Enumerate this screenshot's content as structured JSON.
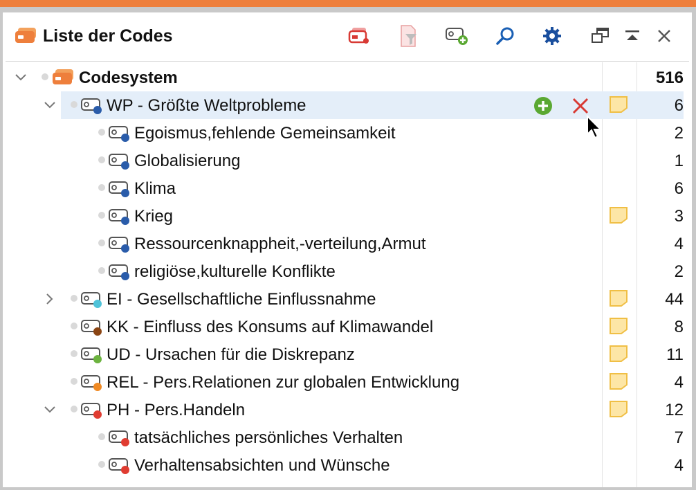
{
  "window": {
    "title": "Liste der Codes",
    "accent_color": "#ee7f3c"
  },
  "toolbar": {
    "buttons": [
      {
        "name": "coded-segments-icon"
      },
      {
        "name": "filter-document-icon"
      },
      {
        "name": "new-code-icon"
      },
      {
        "name": "search-icon"
      },
      {
        "name": "settings-gear-icon"
      },
      {
        "name": "undock-window-icon"
      },
      {
        "name": "collapse-panel-icon"
      },
      {
        "name": "close-icon"
      }
    ]
  },
  "tree": {
    "root": {
      "label": "Codesystem",
      "count": "516"
    },
    "rows": [
      {
        "label": "WP - Größte Weltprobleme",
        "count": "6",
        "level": 1,
        "expanded": true,
        "color": "#2a5caa",
        "memo": true,
        "selected": true
      },
      {
        "label": "Egoismus,fehlende Gemeinsamkeit",
        "count": "2",
        "level": 2,
        "color": "#2a5caa",
        "memo": false
      },
      {
        "label": "Globalisierung",
        "count": "1",
        "level": 2,
        "color": "#2a5caa",
        "memo": false
      },
      {
        "label": "Klima",
        "count": "6",
        "level": 2,
        "color": "#2a5caa",
        "memo": false
      },
      {
        "label": "Krieg",
        "count": "3",
        "level": 2,
        "color": "#2a5caa",
        "memo": true
      },
      {
        "label": "Ressourcenknappheit,-verteilung,Armut",
        "count": "4",
        "level": 2,
        "color": "#2a5caa",
        "memo": false
      },
      {
        "label": "religiöse,kulturelle Konflikte",
        "count": "2",
        "level": 2,
        "color": "#2a5caa",
        "memo": false
      },
      {
        "label": "EI - Gesellschaftliche Einflussnahme",
        "count": "44",
        "level": 1,
        "expanded": false,
        "color": "#4fc3d9",
        "memo": true
      },
      {
        "label": "KK - Einfluss des Konsums auf Klimawandel",
        "count": "8",
        "level": 1,
        "color": "#8b4513",
        "memo": true
      },
      {
        "label": "UD - Ursachen für die Diskrepanz",
        "count": "11",
        "level": 1,
        "color": "#6cb33f",
        "memo": true
      },
      {
        "label": "REL - Pers.Relationen zur globalen Entwicklung",
        "count": "4",
        "level": 1,
        "color": "#f08a24",
        "memo": true
      },
      {
        "label": "PH - Pers.Handeln",
        "count": "12",
        "level": 1,
        "expanded": true,
        "color": "#e03c31",
        "memo": true
      },
      {
        "label": "tatsächliches persönliches Verhalten",
        "count": "7",
        "level": 2,
        "color": "#e03c31",
        "memo": false
      },
      {
        "label": "Verhaltensabsichten und Wünsche",
        "count": "4",
        "level": 2,
        "color": "#e03c31",
        "memo": false
      }
    ]
  },
  "row_actions": {
    "add": {
      "name": "add-subcode-icon",
      "color": "#5aa832"
    },
    "delete": {
      "name": "delete-code-icon",
      "color": "#d83a34"
    }
  }
}
